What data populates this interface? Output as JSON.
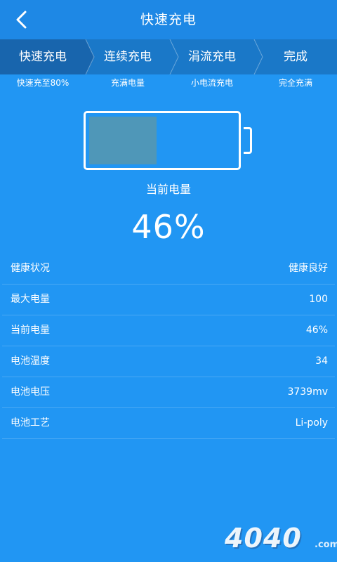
{
  "header": {
    "title": "快速充电",
    "back_icon": "chevron-left-icon"
  },
  "steps": [
    {
      "label": "快速充电",
      "sub": "快速充至80%",
      "active": true
    },
    {
      "label": "连续充电",
      "sub": "充满电量",
      "active": false
    },
    {
      "label": "涓流充电",
      "sub": "小电流充电",
      "active": false
    },
    {
      "label": "完成",
      "sub": "完全充满",
      "active": false
    }
  ],
  "battery": {
    "caption": "当前电量",
    "level_text": "46%",
    "level_fraction": 0.46,
    "fill_color": "#4f97b8"
  },
  "info": [
    {
      "label": "健康状况",
      "value": "健康良好"
    },
    {
      "label": "最大电量",
      "value": "100"
    },
    {
      "label": "当前电量",
      "value": "46%"
    },
    {
      "label": "电池温度",
      "value": "34"
    },
    {
      "label": "电池电压",
      "value": "3739mv"
    },
    {
      "label": "电池工艺",
      "value": "Li-poly"
    }
  ],
  "watermark": {
    "text": "4040",
    "suffix": ".com"
  },
  "colors": {
    "background": "#2196f3",
    "header": "#1e88e5",
    "steps_bar": "#1a78c8",
    "active_step": "#1865ad"
  }
}
